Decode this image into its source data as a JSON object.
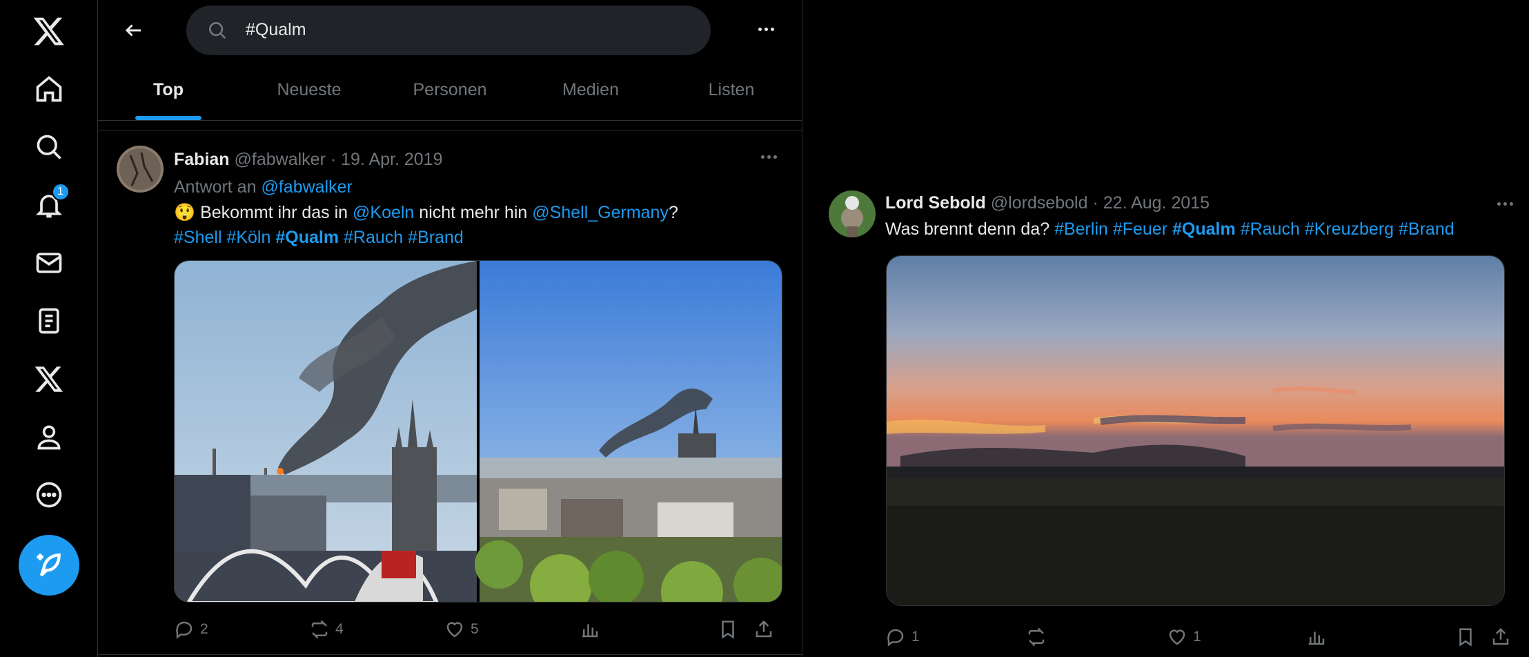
{
  "nav": {
    "notifications_badge": "1"
  },
  "search": {
    "query": "#Qualm"
  },
  "tabs": [
    {
      "label": "Top"
    },
    {
      "label": "Neueste"
    },
    {
      "label": "Personen"
    },
    {
      "label": "Medien"
    },
    {
      "label": "Listen"
    }
  ],
  "tweet1": {
    "name": "Fabian",
    "handle": "@fabwalker",
    "date": "· 19. Apr. 2019",
    "reply_prefix": "Antwort an",
    "reply_to": "@fabwalker",
    "emoji": "😲",
    "text_a": "Bekommt ihr das in",
    "mention_a": "@Koeln",
    "text_b": "nicht mehr hin",
    "mention_b": "@Shell_Germany",
    "text_c": "?",
    "hashtags": [
      "#Shell",
      "#Köln",
      "#Qualm",
      "#Rauch",
      "#Brand"
    ],
    "replies": "2",
    "retweets": "4",
    "likes": "5"
  },
  "tweet2": {
    "name": "Lord Sebold",
    "handle": "@lordsebold",
    "date": "· 22. Aug. 2015",
    "text": "Was brennt denn da?",
    "hashtags": [
      "#Berlin",
      "#Feuer",
      "#Qualm",
      "#Rauch",
      "#Kreuzberg",
      "#Brand"
    ],
    "replies": "1",
    "retweets": "",
    "likes": "1"
  },
  "colors": {
    "accent": "#1d9bf0",
    "background": "#000000",
    "text": "#e7e9ea",
    "muted": "#71767b"
  },
  "icons": [
    "x-logo-icon",
    "home-icon",
    "search-icon",
    "bell-icon",
    "mail-icon",
    "lists-icon",
    "premium-x-icon",
    "profile-icon",
    "more-circle-icon",
    "compose-icon"
  ]
}
